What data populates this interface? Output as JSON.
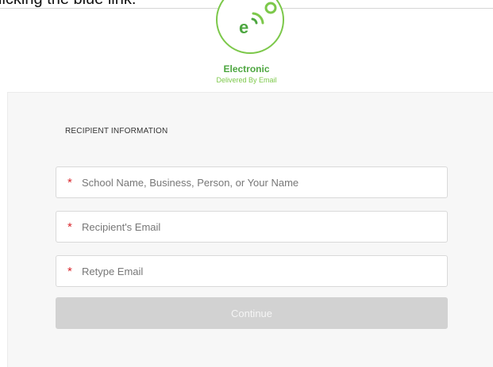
{
  "page_text_top": "licking the blue link.",
  "delivery": {
    "logo_icon": "email-signal-icon",
    "title": "Electronic",
    "subtitle": "Delivered By Email"
  },
  "form": {
    "section_title": "RECIPIENT INFORMATION",
    "required_mark": "*",
    "fields": [
      {
        "placeholder": "School Name, Business, Person, or Your Name",
        "value": ""
      },
      {
        "placeholder": "Recipient's Email",
        "value": ""
      },
      {
        "placeholder": "Retype Email",
        "value": ""
      }
    ],
    "continue_label": "Continue"
  },
  "colors": {
    "accent_green": "#7cc84a",
    "required_red": "#d9262c",
    "disabled_button": "#d2d2d2"
  }
}
